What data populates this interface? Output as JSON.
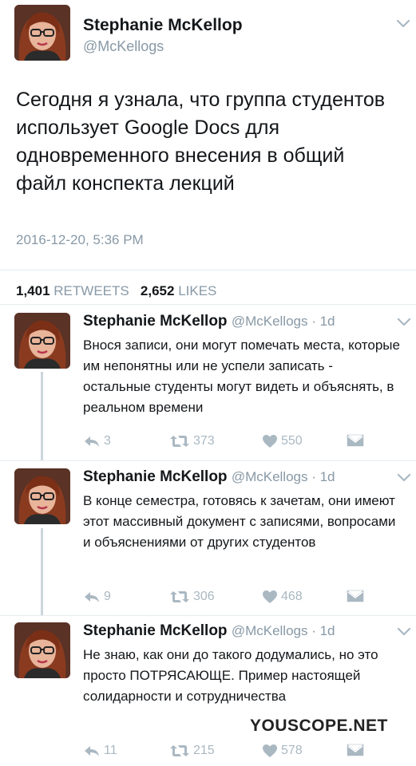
{
  "tweet": {
    "name": "Stephanie McKellop",
    "handle": "@McKellogs",
    "text": "Сегодня я узнала, что группа студентов использует Google Docs для одновременного внесения в общий файл конспекта лекций",
    "timestamp": "2016-12-20, 5:36 PM",
    "retweets_count": "1,401",
    "retweets_label": "RETWEETS",
    "likes_count": "2,652",
    "likes_label": "LIKES"
  },
  "replies": [
    {
      "name": "Stephanie McKellop",
      "meta": "@McKellogs · 1d",
      "text": "Внося записи, они могут помечать места, которые им непонятны или не успели записать - остальные студенты могут видеть и объяснять, в реальном времени",
      "replies": "3",
      "retweets": "373",
      "likes": "550"
    },
    {
      "name": "Stephanie McKellop",
      "meta": "@McKellogs · 1d",
      "text": "В конце семестра, готовясь к зачетам, они имеют этот массивный документ с записями, вопросами и объяснениями от других студентов",
      "replies": "9",
      "retweets": "306",
      "likes": "468"
    },
    {
      "name": "Stephanie McKellop",
      "meta": "@McKellogs · 1d",
      "text": "Не знаю, как они до такого додумались, но это просто ПОТРЯСАЮЩЕ. Пример настоящей солидарности и сотрудничества",
      "replies": "11",
      "retweets": "215",
      "likes": "578"
    }
  ],
  "watermark": "YOUSCOPE.NET",
  "colors": {
    "muted": "#8899a6",
    "icon": "#aab8c2",
    "divider": "#e6ecf0",
    "thread": "#ccd6dd"
  }
}
